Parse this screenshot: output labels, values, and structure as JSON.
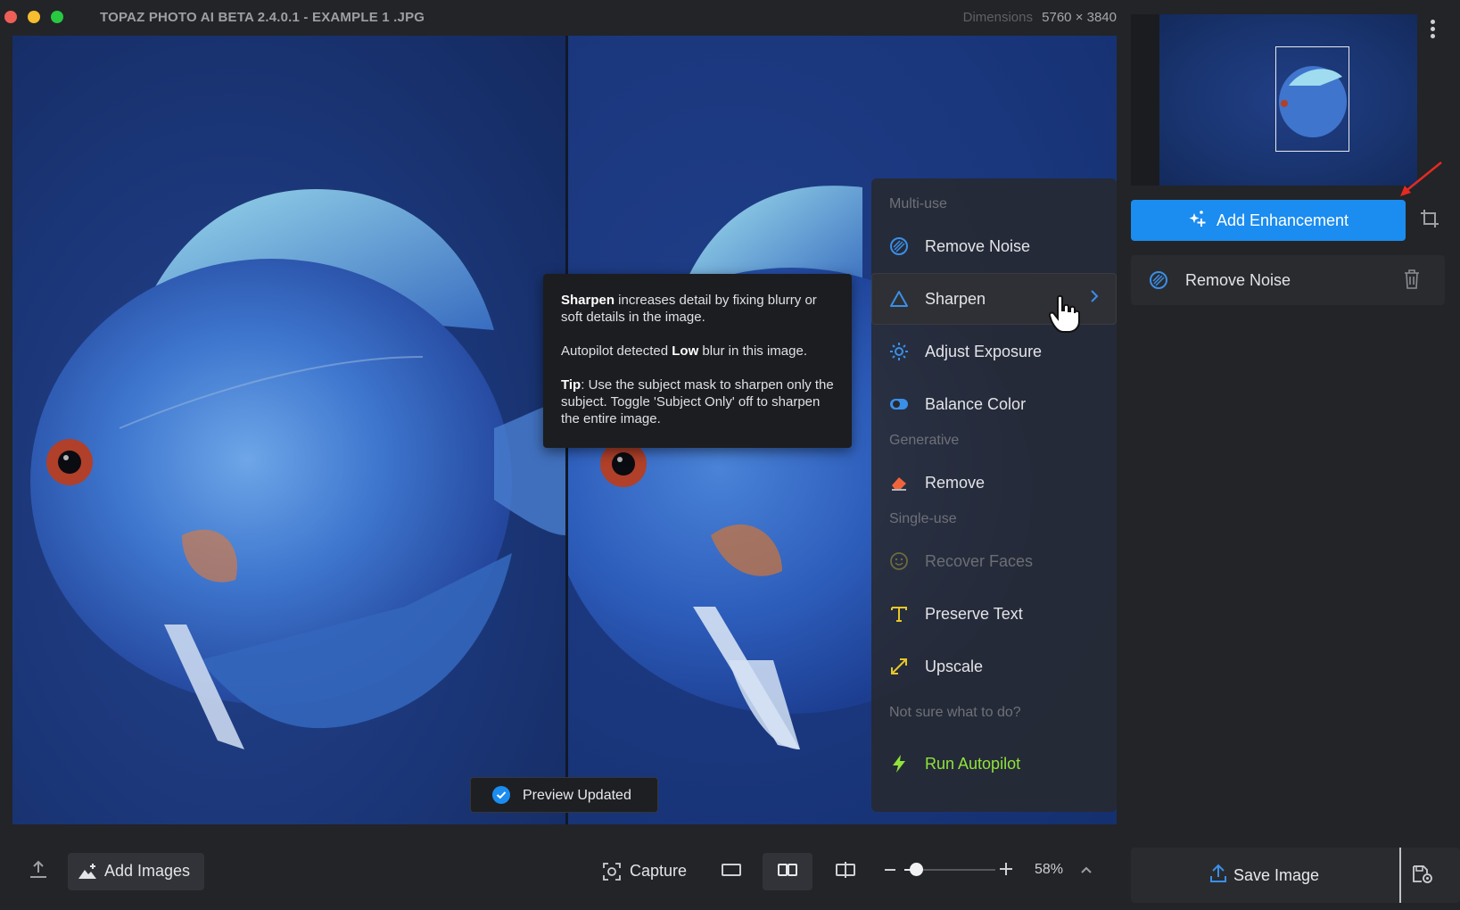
{
  "window": {
    "title": "TOPAZ PHOTO AI BETA 2.4.0.1 - EXAMPLE 1 .JPG",
    "dimensions_label": "Dimensions",
    "dimensions_value": "5760 × 3840"
  },
  "tooltip": {
    "line1_bold": "Sharpen",
    "line1_rest": " increases detail by fixing blurry or soft details in the image.",
    "line2_pre": "Autopilot detected ",
    "line2_bold": "Low",
    "line2_post": " blur in this image.",
    "line3_bold": "Tip",
    "line3_rest": ": Use the subject mask to sharpen only the subject. Toggle 'Subject Only' off to sharpen the entire image."
  },
  "menu": {
    "section_multi": "Multi-use",
    "section_generative": "Generative",
    "section_single": "Single-use",
    "section_unsure": "Not sure what to do?",
    "items": {
      "remove_noise": "Remove Noise",
      "sharpen": "Sharpen",
      "adjust_exposure": "Adjust Exposure",
      "balance_color": "Balance Color",
      "remove": "Remove",
      "recover_faces": "Recover Faces",
      "preserve_text": "Preserve Text",
      "upscale": "Upscale",
      "run_autopilot": "Run Autopilot"
    },
    "icons": {
      "remove_noise": "noise-circle-icon",
      "sharpen": "triangle-icon",
      "adjust_exposure": "sun-icon",
      "balance_color": "color-toggle-icon",
      "remove": "eraser-icon",
      "recover_faces": "smiley-icon",
      "preserve_text": "text-t-icon",
      "upscale": "diagonal-arrow-icon",
      "run_autopilot": "lightning-icon"
    }
  },
  "toast": {
    "label": "Preview Updated"
  },
  "sidebar": {
    "add_enhancement_label": "Add Enhancement",
    "applied": [
      {
        "label": "Remove Noise"
      }
    ]
  },
  "toolbar": {
    "add_images_label": "Add Images",
    "capture_label": "Capture",
    "zoom_percent": "58%",
    "zoom_fraction": 0.09
  },
  "save": {
    "label": "Save Image"
  },
  "colors": {
    "accent_blue": "#1b8cf0",
    "autopilot_green": "#8fe33a",
    "remove_orange": "#f0643c",
    "text_yellow": "#e8c628",
    "annotation_red": "#e42a23"
  }
}
